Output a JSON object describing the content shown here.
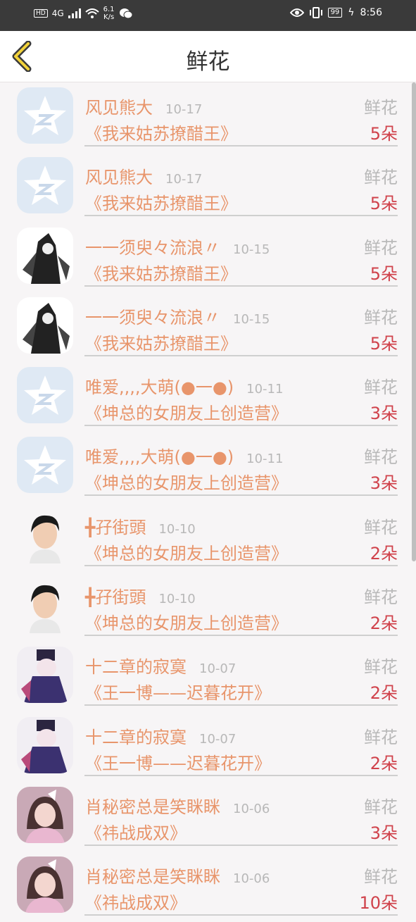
{
  "status_bar": {
    "network": "HD",
    "signal": "4G",
    "speed_value": "6.1",
    "speed_unit": "K/s",
    "battery": "99",
    "time": "8:56"
  },
  "header": {
    "title": "鲜花"
  },
  "entries": [
    {
      "name": "风见熊大",
      "date": "10-17",
      "type": "鲜花",
      "work": "《我来姑苏撩醋王》",
      "count": "5朵",
      "avatar": "qq-star"
    },
    {
      "name": "风见熊大",
      "date": "10-17",
      "type": "鲜花",
      "work": "《我来姑苏撩醋王》",
      "count": "5朵",
      "avatar": "qq-star"
    },
    {
      "name": "一一须臾々流浪〃",
      "date": "10-15",
      "type": "鲜花",
      "work": "《我来姑苏撩醋王》",
      "count": "5朵",
      "avatar": "ink-portrait"
    },
    {
      "name": "一一须臾々流浪〃",
      "date": "10-15",
      "type": "鲜花",
      "work": "《我来姑苏撩醋王》",
      "count": "5朵",
      "avatar": "ink-portrait"
    },
    {
      "name": "唯爱,,,,大萌(●一●)",
      "date": "10-11",
      "type": "鲜花",
      "work": "《坤总的女朋友上创造营》",
      "count": "3朵",
      "avatar": "qq-star"
    },
    {
      "name": "唯爱,,,,大萌(●一●)",
      "date": "10-11",
      "type": "鲜花",
      "work": "《坤总的女朋友上创造营》",
      "count": "3朵",
      "avatar": "qq-star"
    },
    {
      "name": "╋孖街頭",
      "date": "10-10",
      "type": "鲜花",
      "work": "《坤总的女朋友上创造营》",
      "count": "2朵",
      "avatar": "boy"
    },
    {
      "name": "╋孖街頭",
      "date": "10-10",
      "type": "鲜花",
      "work": "《坤总的女朋友上创造营》",
      "count": "2朵",
      "avatar": "boy"
    },
    {
      "name": "十二章的寂寞",
      "date": "10-07",
      "type": "鲜花",
      "work": "《王一博——迟暮花开》",
      "count": "2朵",
      "avatar": "anime"
    },
    {
      "name": "十二章的寂寞",
      "date": "10-07",
      "type": "鲜花",
      "work": "《王一博——迟暮花开》",
      "count": "2朵",
      "avatar": "anime"
    },
    {
      "name": "肖秘密总是笑眯眯",
      "date": "10-06",
      "type": "鲜花",
      "work": "《祎战成双》",
      "count": "3朵",
      "avatar": "girl"
    },
    {
      "name": "肖秘密总是笑眯眯",
      "date": "10-06",
      "type": "鲜花",
      "work": "《祎战成双》",
      "count": "10朵",
      "avatar": "girl"
    }
  ]
}
